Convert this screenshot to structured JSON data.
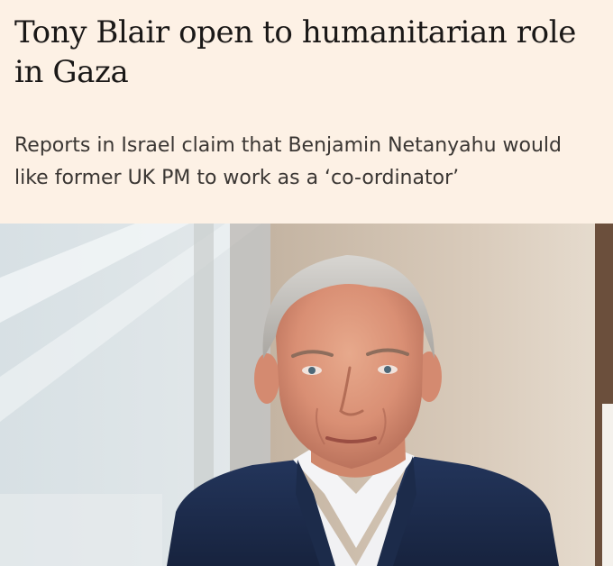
{
  "article": {
    "headline": "Tony Blair open to humanitarian role in Gaza",
    "standfirst": "Reports in Israel claim that Benjamin Netanyahu would like former UK PM to work as a ‘co-ordinator’"
  },
  "colors": {
    "page_background": "#fdf1e5",
    "headline_text": "#1a1817",
    "standfirst_text": "#3a3633"
  }
}
